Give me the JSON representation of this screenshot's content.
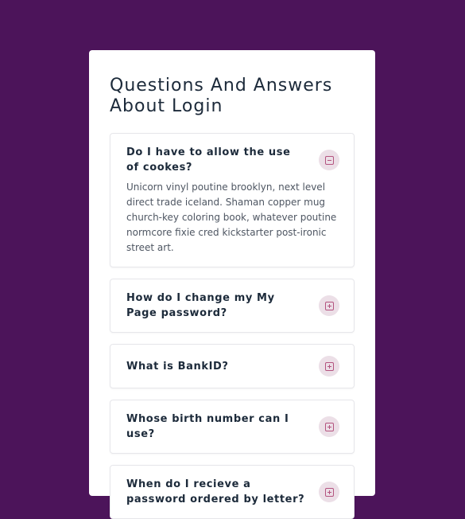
{
  "page": {
    "title": "Questions And Answers About Login"
  },
  "faq": [
    {
      "question": "Do I have to allow the use of cookes?",
      "answer": "Unicorn vinyl poutine brooklyn, next level direct trade iceland. Shaman copper mug church-key coloring book, whatever poutine normcore fixie cred kickstarter post-ironic street art.",
      "expanded": true,
      "toggle_icon": "minus-square-icon"
    },
    {
      "question": "How do I change my My Page password?",
      "expanded": false,
      "toggle_icon": "plus-square-icon"
    },
    {
      "question": "What is BankID?",
      "expanded": false,
      "toggle_icon": "plus-square-icon"
    },
    {
      "question": "Whose birth number can I use?",
      "expanded": false,
      "toggle_icon": "plus-square-icon"
    },
    {
      "question": "When do I recieve a password ordered by letter?",
      "expanded": false,
      "toggle_icon": "plus-square-icon"
    }
  ],
  "colors": {
    "background": "#4c145a",
    "card": "#ffffff",
    "text": "#1c2a3a",
    "answer_text": "#4e5662",
    "toggle_bg": "#ecdfe7",
    "toggle_icon": "#b4537f"
  }
}
